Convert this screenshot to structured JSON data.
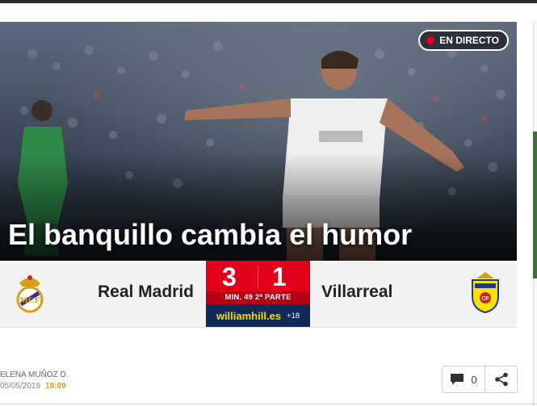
{
  "hero": {
    "live_label": "EN DIRECTO",
    "headline": "El banquillo cambia el humor"
  },
  "match": {
    "home_team": "Real Madrid",
    "away_team": "Villarreal",
    "home_score": "3",
    "away_score": "1",
    "minute_label": "MIN. 49 2ª PARTE",
    "bookmaker": "williamhill.es",
    "age_label": "+18"
  },
  "article": {
    "author": "ELENA MUÑOZ D.",
    "date": "05/05/2019",
    "time": "18:09",
    "comment_count": "0"
  },
  "colors": {
    "accent_red": "#e2001a",
    "bookie_navy": "#0f2a55",
    "bookie_yellow": "#ffd800"
  }
}
